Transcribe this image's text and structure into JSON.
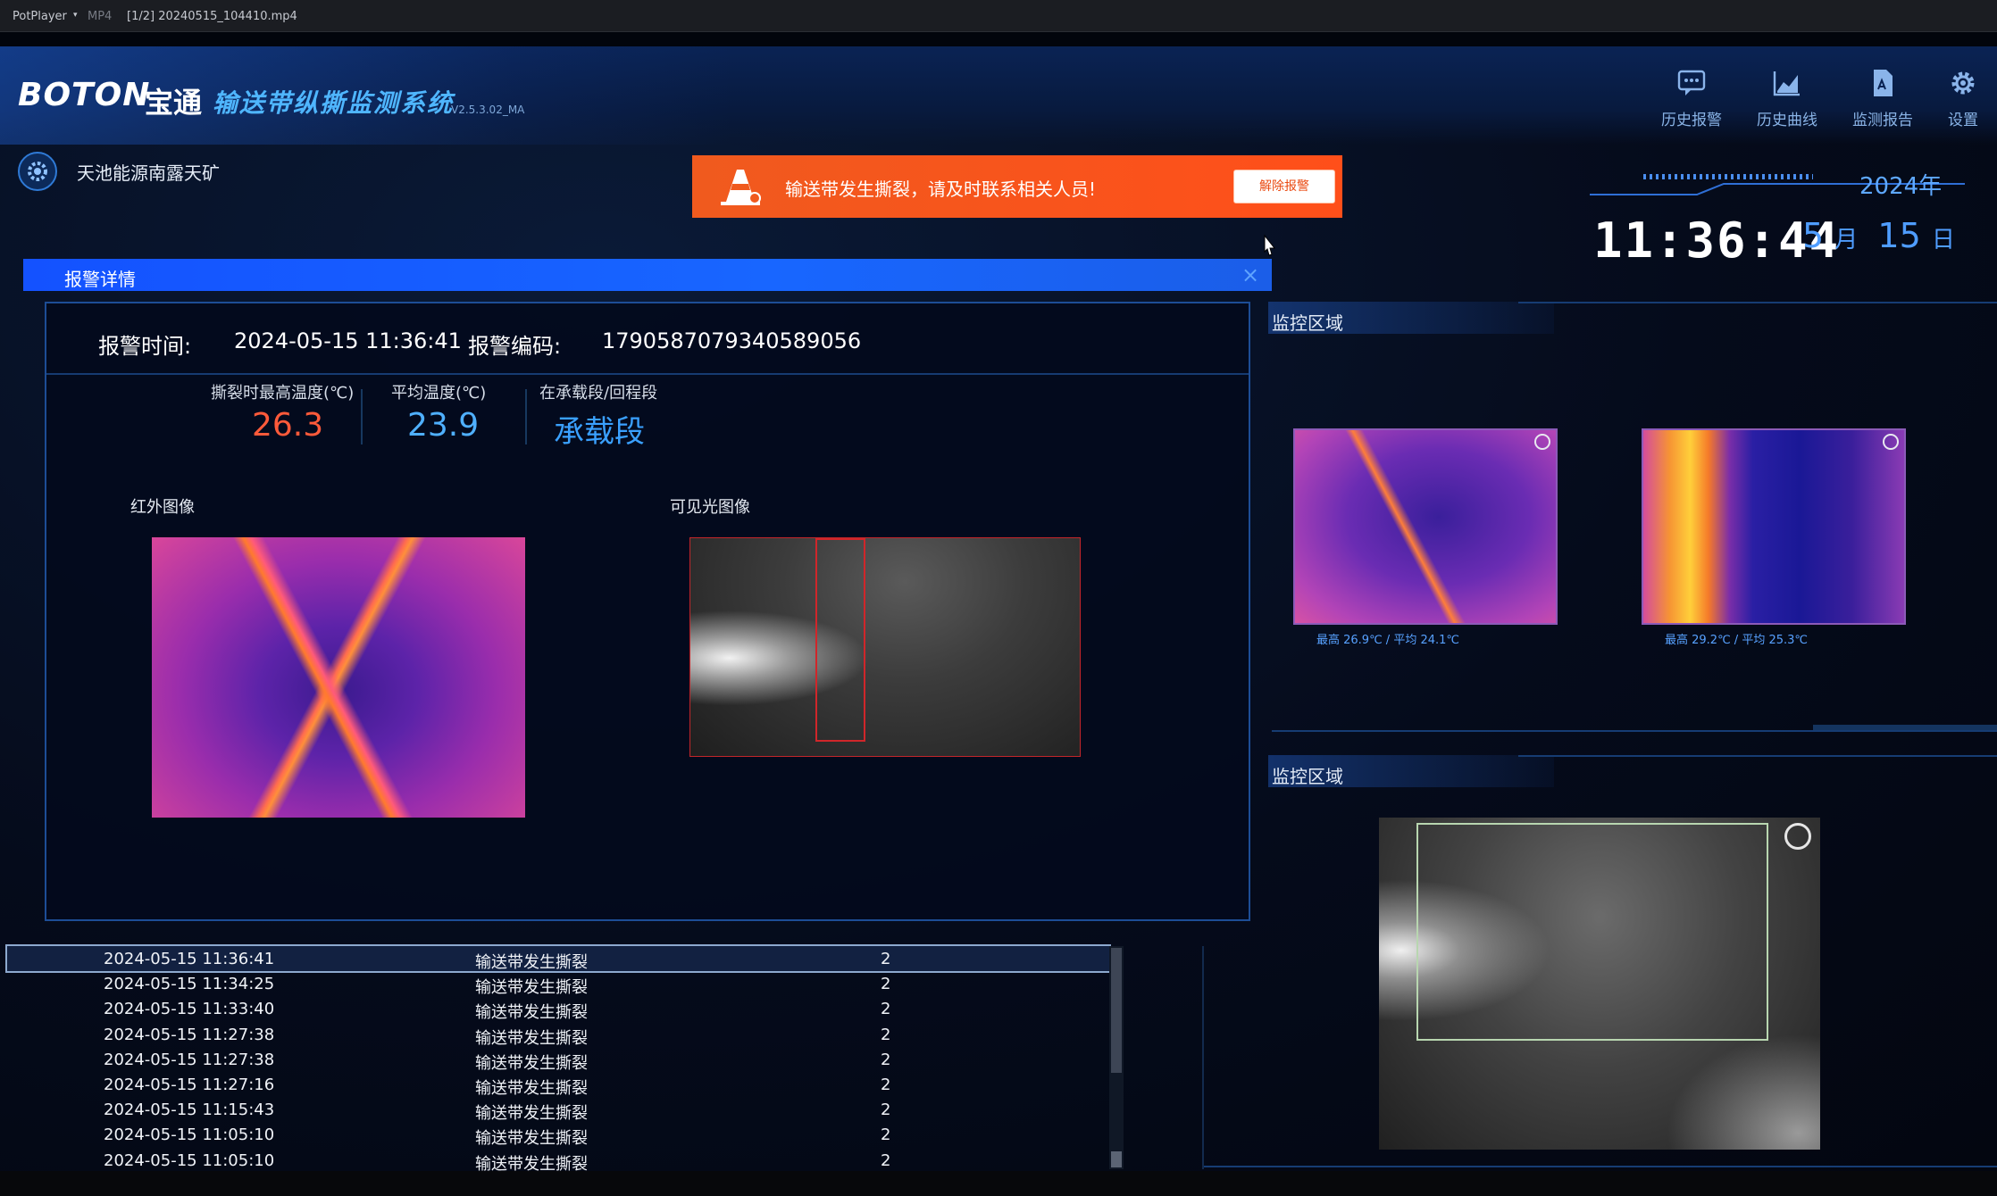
{
  "player": {
    "app_name": "PotPlayer",
    "format": "MP4",
    "file": "[1/2] 20240515_104410.mp4"
  },
  "header": {
    "brand": "BOTON",
    "brand_cn": "宝通",
    "title": "输送带纵撕监测系统",
    "version": "V2.5.3.02_MA"
  },
  "nav": {
    "history_alarm": "历史报警",
    "history_curve": "历史曲线",
    "monitor_report": "监测报告",
    "settings": "设置"
  },
  "site": {
    "name": "天池能源南露天矿"
  },
  "clock": {
    "year": "2024年",
    "time": "11:36:44",
    "month": "5",
    "month_unit": "月",
    "day": "15",
    "day_unit": "日"
  },
  "alert": {
    "message": "输送带发生撕裂，请及时联系相关人员!",
    "dismiss_label": "解除报警"
  },
  "detail": {
    "title": "报警详情",
    "close": "×",
    "time_label": "报警时间:",
    "time_value": "2024-05-15 11:36:41",
    "code_label": "报警编码:",
    "code_value": "1790587079340589056",
    "max_temp_label": "撕裂时最高温度(℃)",
    "max_temp_value": "26.3",
    "avg_temp_label": "平均温度(℃)",
    "avg_temp_value": "23.9",
    "segment_label": "在承载段/回程段",
    "segment_value": "承载段",
    "ir_label": "红外图像",
    "visible_label": "可见光图像"
  },
  "right": {
    "zone1_title": "监控区域",
    "zone2_title": "监控区域",
    "cam1_caption": "最高 26.9℃   /   平均 24.1℃",
    "cam2_caption": "最高 29.2℃   /   平均 25.3℃"
  },
  "alarms": [
    {
      "time": "2024-05-15 11:36:41",
      "event": "输送带发生撕裂",
      "count": "2",
      "selected": true
    },
    {
      "time": "2024-05-15 11:34:25",
      "event": "输送带发生撕裂",
      "count": "2"
    },
    {
      "time": "2024-05-15 11:33:40",
      "event": "输送带发生撕裂",
      "count": "2"
    },
    {
      "time": "2024-05-15 11:27:38",
      "event": "输送带发生撕裂",
      "count": "2"
    },
    {
      "time": "2024-05-15 11:27:38",
      "event": "输送带发生撕裂",
      "count": "2"
    },
    {
      "time": "2024-05-15 11:27:16",
      "event": "输送带发生撕裂",
      "count": "2"
    },
    {
      "time": "2024-05-15 11:15:43",
      "event": "输送带发生撕裂",
      "count": "2"
    },
    {
      "time": "2024-05-15 11:05:10",
      "event": "输送带发生撕裂",
      "count": "2"
    },
    {
      "time": "2024-05-15 11:05:10",
      "event": "输送带发生撕裂",
      "count": "2"
    }
  ],
  "colors": {
    "accent": "#1866ff",
    "alert": "#f05a1e",
    "max_temp": "#ff5a3a",
    "avg_temp": "#4fb0ff",
    "segment": "#3aa0ff"
  }
}
